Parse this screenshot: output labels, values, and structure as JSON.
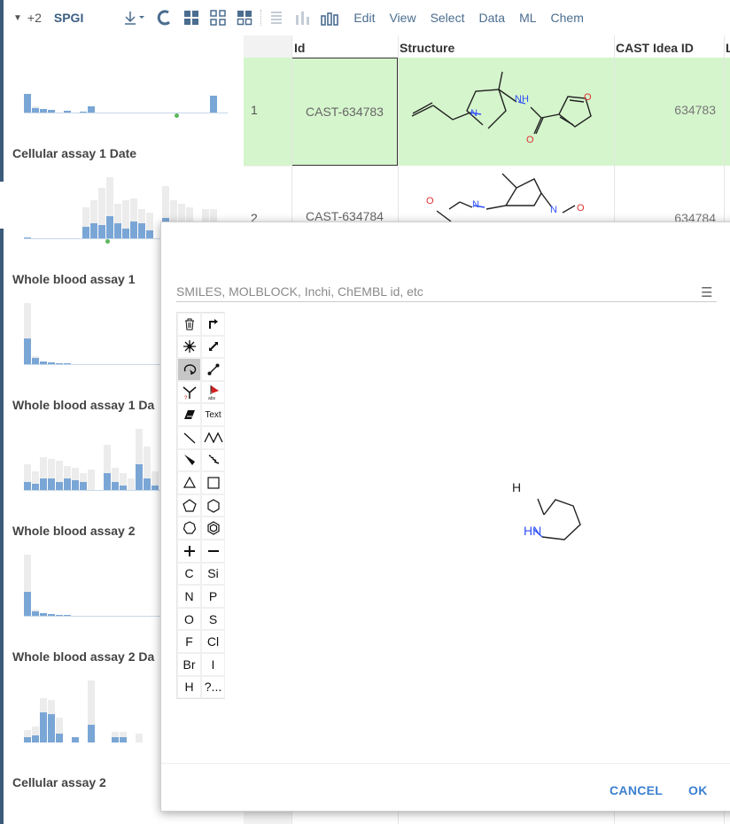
{
  "toolbar": {
    "expand_count": "+2",
    "title": "SPGI",
    "menus": [
      "Edit",
      "View",
      "Select",
      "Data",
      "ML",
      "Chem"
    ]
  },
  "filters": [
    {
      "label": "Cellular assay 1 Date"
    },
    {
      "label": "Whole blood assay 1"
    },
    {
      "label": "Whole blood assay 1 Da"
    },
    {
      "label": "Whole blood assay 2"
    },
    {
      "label": "Whole blood assay 2 Da"
    },
    {
      "label": "Cellular assay 2"
    }
  ],
  "grid": {
    "headers": [
      "Id",
      "Structure",
      "CAST Idea ID",
      "L"
    ],
    "rows": [
      {
        "num": "1",
        "id": "CAST-634783",
        "cast_idea_id": "634783"
      },
      {
        "num": "2",
        "id": "CAST-634784",
        "cast_idea_id": "634784"
      }
    ]
  },
  "dialog": {
    "smiles_placeholder": "SMILES, MOLBLOCK, Inchi, ChEMBL id, etc",
    "palette_labels": [
      "Text",
      "C",
      "Si",
      "N",
      "P",
      "O",
      "S",
      "F",
      "Cl",
      "Br",
      "I",
      "H",
      "?..."
    ],
    "atom_labels": {
      "h": "H",
      "hn": "HN"
    },
    "cancel_label": "CANCEL",
    "ok_label": "OK"
  },
  "colors": {
    "accent": "#3b7fd0",
    "selected_row": "#d5f5cc",
    "histogram_blue": "#7aa6d6",
    "nitrogen_blue": "#3050f8",
    "oxygen_red": "#e03030"
  }
}
